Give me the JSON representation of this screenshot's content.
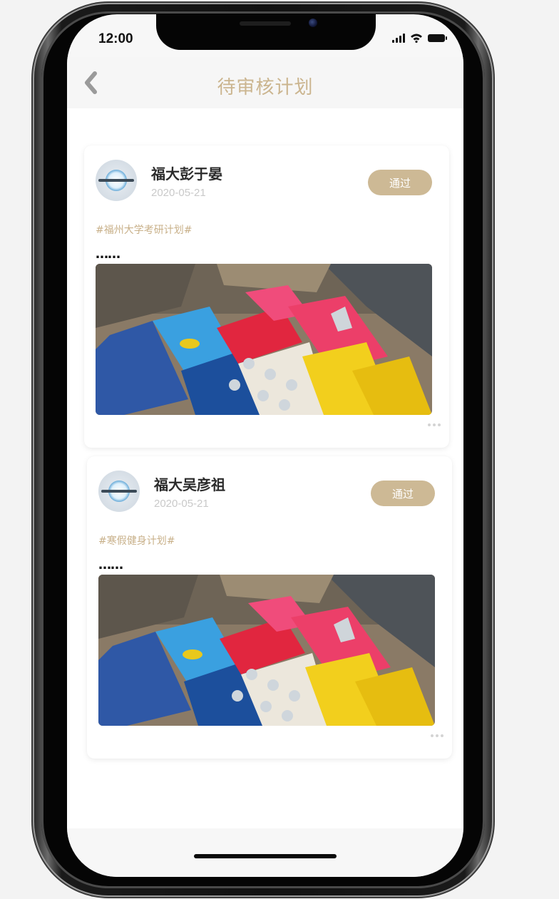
{
  "status_bar": {
    "time": "12:00",
    "signal_icon": "cellular-signal-icon",
    "wifi_icon": "wifi-icon",
    "battery_icon": "battery-icon"
  },
  "nav": {
    "back_icon": "chevron-left-icon",
    "title": "待审核计划",
    "title_color": "#cbb58f"
  },
  "theme": {
    "accent": "#cdb995",
    "tag_color": "#c8b089",
    "date_color": "#c9c9c9"
  },
  "cards": [
    {
      "avatar_icon": "avatar-icon",
      "user_name": "福大彭于晏",
      "date": "2020-05-21",
      "approve_label": "通过",
      "tag": "#福州大学考研计划#",
      "text": "……",
      "image_icon": "lego-house-photo",
      "more_icon": "more-dots-icon"
    },
    {
      "avatar_icon": "avatar-icon",
      "user_name": "福大吴彦祖",
      "date": "2020-05-21",
      "approve_label": "通过",
      "tag": "#寒假健身计划#",
      "text": "……",
      "image_icon": "lego-house-photo",
      "more_icon": "more-dots-icon"
    }
  ]
}
